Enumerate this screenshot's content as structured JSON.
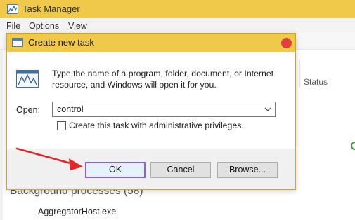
{
  "task_manager": {
    "title": "Task Manager",
    "menu": [
      "File",
      "Options",
      "View"
    ],
    "column_status": "Status",
    "section_label": "Background processes (58)",
    "process_name": "AggregatorHost.exe"
  },
  "dialog": {
    "title": "Create new task",
    "prompt": "Type the name of a program, folder, document, or Internet resource, and Windows will open it for you.",
    "open_label": "Open:",
    "open_value": "control",
    "admin_label": "Create this task with administrative privileges.",
    "admin_checked": false,
    "buttons": {
      "ok": "OK",
      "cancel": "Cancel",
      "browse": "Browse..."
    }
  },
  "colors": {
    "titlebar": "#f0c94a",
    "close_button": "#e0413a",
    "ok_focus_border": "#8a62d6",
    "arrow": "#e0262a"
  },
  "icons": [
    "task-manager-icon",
    "run-dialog-icon",
    "close-icon",
    "chevron-down-icon",
    "annotation-arrow"
  ]
}
